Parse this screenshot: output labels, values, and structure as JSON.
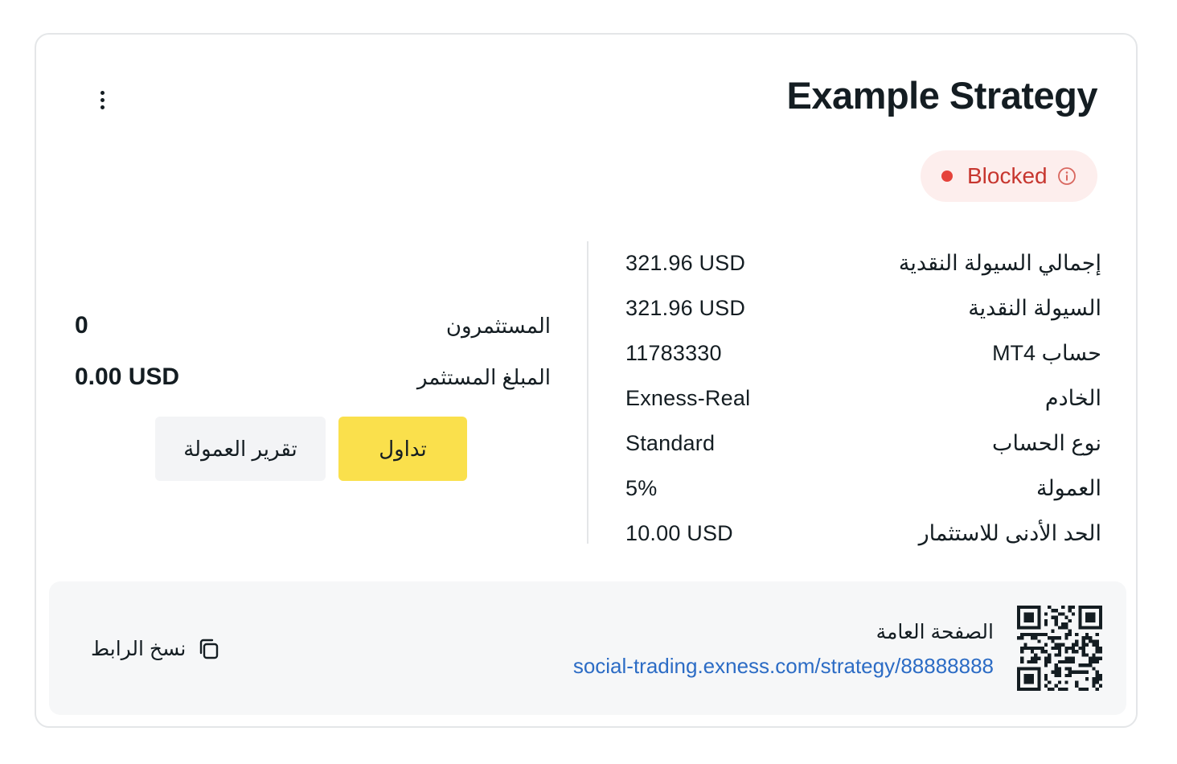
{
  "strategy": {
    "title": "Example Strategy",
    "status_label": "Blocked",
    "status_color": "#e5423a"
  },
  "stats": [
    {
      "label": "إجمالي السيولة النقدية",
      "value": "321.96 USD"
    },
    {
      "label": "السيولة النقدية",
      "value": "321.96 USD"
    },
    {
      "label": "حساب MT4",
      "value": "11783330"
    },
    {
      "label": "الخادم",
      "value": "Exness-Real"
    },
    {
      "label": "نوع الحساب",
      "value": "Standard"
    },
    {
      "label": "العمولة",
      "value": "5%"
    },
    {
      "label": "الحد الأدنى للاستثمار",
      "value": "10.00 USD"
    }
  ],
  "investors": {
    "label": "المستثمرون",
    "value": "0"
  },
  "invested": {
    "label": "المبلغ المستثمر",
    "value": "0.00 USD"
  },
  "buttons": {
    "trade_label": "تداول",
    "trade_color": "#fae04c",
    "report_label": "تقرير العمولة"
  },
  "footer": {
    "copy_label": "نسخ الرابط",
    "public_label": "الصفحة العامة",
    "public_url": "social-trading.exness.com/strategy/88888888"
  },
  "icons": {
    "menu": "kebab-menu-icon",
    "status": "info-icon",
    "copy": "copy-icon",
    "qr": "qr-code"
  }
}
